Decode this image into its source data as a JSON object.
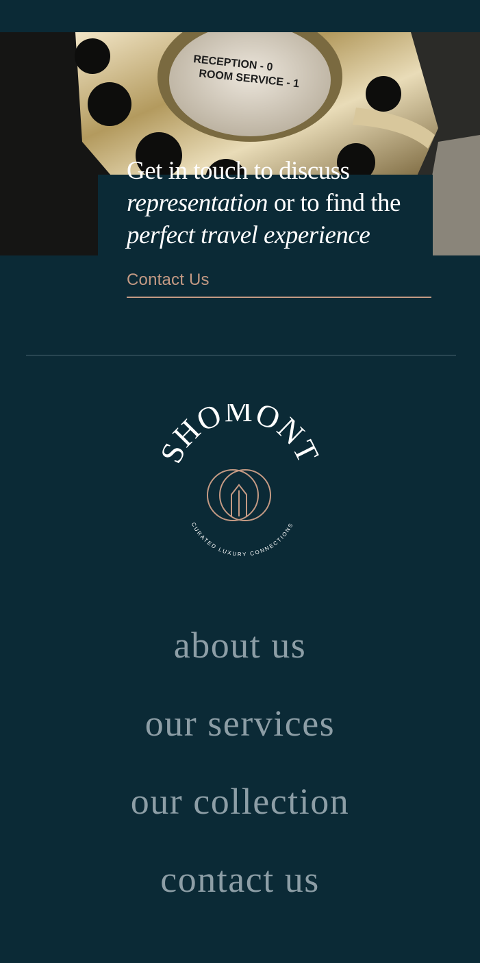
{
  "hero": {
    "dial_label_line1": "RECEPTION - 0",
    "dial_label_line2": "ROOM SERVICE - 1",
    "headline": {
      "part1": "Get in touch to discuss",
      "part2_italic": "representation",
      "part3": " or to find the",
      "part4_italic": "perfect travel experience"
    },
    "cta_label": "Contact Us"
  },
  "logo": {
    "name": "SHOMONT",
    "tagline": "CURATED LUXURY CONNECTIONS",
    "icon": "double-ring-house-icon"
  },
  "nav": {
    "items": [
      {
        "label": "about us"
      },
      {
        "label": "our services"
      },
      {
        "label": "our collection"
      },
      {
        "label": "contact us"
      }
    ]
  },
  "colors": {
    "background": "#0b2a36",
    "accent": "#c49a84",
    "nav_text": "#8d9ea6",
    "headline_text": "#ffffff"
  }
}
